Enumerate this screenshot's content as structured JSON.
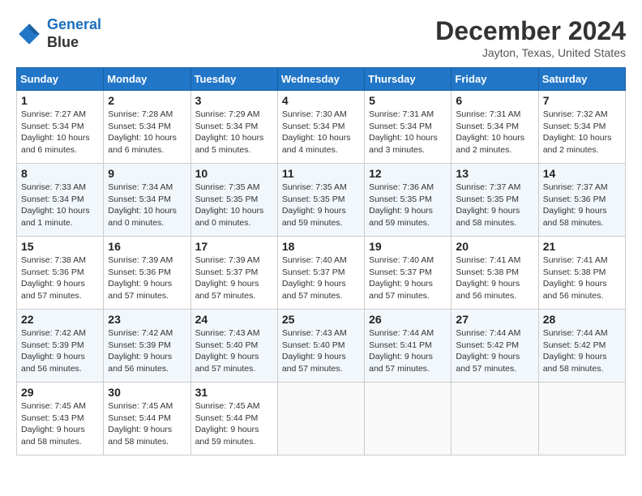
{
  "header": {
    "logo_line1": "General",
    "logo_line2": "Blue",
    "month": "December 2024",
    "location": "Jayton, Texas, United States"
  },
  "days_of_week": [
    "Sunday",
    "Monday",
    "Tuesday",
    "Wednesday",
    "Thursday",
    "Friday",
    "Saturday"
  ],
  "weeks": [
    [
      {
        "day": "1",
        "sunrise": "7:27 AM",
        "sunset": "5:34 PM",
        "daylight": "10 hours and 6 minutes."
      },
      {
        "day": "2",
        "sunrise": "7:28 AM",
        "sunset": "5:34 PM",
        "daylight": "10 hours and 6 minutes."
      },
      {
        "day": "3",
        "sunrise": "7:29 AM",
        "sunset": "5:34 PM",
        "daylight": "10 hours and 5 minutes."
      },
      {
        "day": "4",
        "sunrise": "7:30 AM",
        "sunset": "5:34 PM",
        "daylight": "10 hours and 4 minutes."
      },
      {
        "day": "5",
        "sunrise": "7:31 AM",
        "sunset": "5:34 PM",
        "daylight": "10 hours and 3 minutes."
      },
      {
        "day": "6",
        "sunrise": "7:31 AM",
        "sunset": "5:34 PM",
        "daylight": "10 hours and 2 minutes."
      },
      {
        "day": "7",
        "sunrise": "7:32 AM",
        "sunset": "5:34 PM",
        "daylight": "10 hours and 2 minutes."
      }
    ],
    [
      {
        "day": "8",
        "sunrise": "7:33 AM",
        "sunset": "5:34 PM",
        "daylight": "10 hours and 1 minute."
      },
      {
        "day": "9",
        "sunrise": "7:34 AM",
        "sunset": "5:34 PM",
        "daylight": "10 hours and 0 minutes."
      },
      {
        "day": "10",
        "sunrise": "7:35 AM",
        "sunset": "5:35 PM",
        "daylight": "10 hours and 0 minutes."
      },
      {
        "day": "11",
        "sunrise": "7:35 AM",
        "sunset": "5:35 PM",
        "daylight": "9 hours and 59 minutes."
      },
      {
        "day": "12",
        "sunrise": "7:36 AM",
        "sunset": "5:35 PM",
        "daylight": "9 hours and 59 minutes."
      },
      {
        "day": "13",
        "sunrise": "7:37 AM",
        "sunset": "5:35 PM",
        "daylight": "9 hours and 58 minutes."
      },
      {
        "day": "14",
        "sunrise": "7:37 AM",
        "sunset": "5:36 PM",
        "daylight": "9 hours and 58 minutes."
      }
    ],
    [
      {
        "day": "15",
        "sunrise": "7:38 AM",
        "sunset": "5:36 PM",
        "daylight": "9 hours and 57 minutes."
      },
      {
        "day": "16",
        "sunrise": "7:39 AM",
        "sunset": "5:36 PM",
        "daylight": "9 hours and 57 minutes."
      },
      {
        "day": "17",
        "sunrise": "7:39 AM",
        "sunset": "5:37 PM",
        "daylight": "9 hours and 57 minutes."
      },
      {
        "day": "18",
        "sunrise": "7:40 AM",
        "sunset": "5:37 PM",
        "daylight": "9 hours and 57 minutes."
      },
      {
        "day": "19",
        "sunrise": "7:40 AM",
        "sunset": "5:37 PM",
        "daylight": "9 hours and 57 minutes."
      },
      {
        "day": "20",
        "sunrise": "7:41 AM",
        "sunset": "5:38 PM",
        "daylight": "9 hours and 56 minutes."
      },
      {
        "day": "21",
        "sunrise": "7:41 AM",
        "sunset": "5:38 PM",
        "daylight": "9 hours and 56 minutes."
      }
    ],
    [
      {
        "day": "22",
        "sunrise": "7:42 AM",
        "sunset": "5:39 PM",
        "daylight": "9 hours and 56 minutes."
      },
      {
        "day": "23",
        "sunrise": "7:42 AM",
        "sunset": "5:39 PM",
        "daylight": "9 hours and 56 minutes."
      },
      {
        "day": "24",
        "sunrise": "7:43 AM",
        "sunset": "5:40 PM",
        "daylight": "9 hours and 57 minutes."
      },
      {
        "day": "25",
        "sunrise": "7:43 AM",
        "sunset": "5:40 PM",
        "daylight": "9 hours and 57 minutes."
      },
      {
        "day": "26",
        "sunrise": "7:44 AM",
        "sunset": "5:41 PM",
        "daylight": "9 hours and 57 minutes."
      },
      {
        "day": "27",
        "sunrise": "7:44 AM",
        "sunset": "5:42 PM",
        "daylight": "9 hours and 57 minutes."
      },
      {
        "day": "28",
        "sunrise": "7:44 AM",
        "sunset": "5:42 PM",
        "daylight": "9 hours and 58 minutes."
      }
    ],
    [
      {
        "day": "29",
        "sunrise": "7:45 AM",
        "sunset": "5:43 PM",
        "daylight": "9 hours and 58 minutes."
      },
      {
        "day": "30",
        "sunrise": "7:45 AM",
        "sunset": "5:44 PM",
        "daylight": "9 hours and 58 minutes."
      },
      {
        "day": "31",
        "sunrise": "7:45 AM",
        "sunset": "5:44 PM",
        "daylight": "9 hours and 59 minutes."
      },
      null,
      null,
      null,
      null
    ]
  ]
}
